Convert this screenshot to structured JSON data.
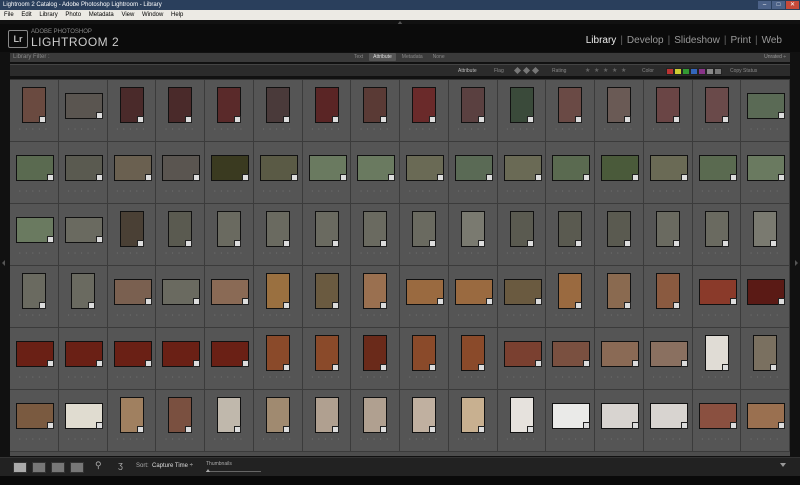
{
  "window": {
    "title": "Lightroom 2 Catalog - Adobe Photoshop Lightroom - Library",
    "controls": [
      "–",
      "□",
      "✕"
    ]
  },
  "menu": [
    "File",
    "Edit",
    "Library",
    "Photo",
    "Metadata",
    "View",
    "Window",
    "Help"
  ],
  "logo": {
    "badge": "Lr",
    "subtitle": "ADOBE PHOTOSHOP",
    "title": "LIGHTROOM 2"
  },
  "modules": [
    {
      "label": "Library",
      "active": true
    },
    {
      "label": "Develop",
      "active": false
    },
    {
      "label": "Slideshow",
      "active": false
    },
    {
      "label": "Print",
      "active": false
    },
    {
      "label": "Web",
      "active": false
    }
  ],
  "filter": {
    "title": "Library Filter :",
    "tabs": [
      {
        "label": "Text",
        "active": false
      },
      {
        "label": "Attribute",
        "active": true
      },
      {
        "label": "Metadata",
        "active": false
      },
      {
        "label": "None",
        "active": false
      }
    ],
    "preset": "Unrated ÷"
  },
  "attribute_bar": {
    "attribute_label": "Attribute",
    "flag_label": "Flag",
    "rating_label": "Rating",
    "color_label": "Color",
    "copy_status_label": "Copy Status",
    "colors": [
      "#b33",
      "#cc3",
      "#393",
      "#36b",
      "#838",
      "#888",
      "#777"
    ]
  },
  "thumbnails": [
    "p",
    "l",
    "p",
    "p",
    "p",
    "p",
    "p",
    "p",
    "p",
    "p",
    "p",
    "p",
    "p",
    "p",
    "p",
    "l",
    "l",
    "l",
    "l",
    "l",
    "l",
    "l",
    "l",
    "l",
    "l",
    "l",
    "l",
    "l",
    "l",
    "l",
    "l",
    "l",
    "l",
    "l",
    "p",
    "p",
    "p",
    "p",
    "p",
    "p",
    "p",
    "p",
    "p",
    "p",
    "p",
    "p",
    "p",
    "p",
    "p",
    "p",
    "l",
    "l",
    "l",
    "p",
    "p",
    "p",
    "l",
    "l",
    "l",
    "p",
    "p",
    "p",
    "l",
    "l",
    "l",
    "l",
    "l",
    "l",
    "l",
    "p",
    "p",
    "p",
    "p",
    "p",
    "l",
    "l",
    "l",
    "l",
    "p",
    "p",
    "l",
    "l",
    "p",
    "p",
    "p",
    "p",
    "p",
    "p",
    "p",
    "p",
    "p",
    "l",
    "l",
    "l",
    "l",
    "l"
  ],
  "thumb_colors": [
    "#6a4a40",
    "#5a5550",
    "#4a2a2a",
    "#4a2a2a",
    "#5a2a2a",
    "#4a3a3a",
    "#5a2525",
    "#5a3a35",
    "#6a2a2a",
    "#5a4040",
    "#3a4a3a",
    "#6a4a45",
    "#6a5a55",
    "#6a4545",
    "#6a4a4a",
    "#5a6a55",
    "#5a6a50",
    "#5a5a50",
    "#6a6050",
    "#5a5550",
    "#3a3a20",
    "#5a5a45",
    "#6a7a60",
    "#6a7a60",
    "#6a6a55",
    "#5a6a55",
    "#6a6a55",
    "#5a6a50",
    "#4a5a3a",
    "#6a6a55",
    "#5a6a50",
    "#6a7a60",
    "#6a7a60",
    "#6a6a60",
    "#4a4035",
    "#5a5a50",
    "#6a6a60",
    "#6a6a60",
    "#6a6a60",
    "#6a6a60",
    "#6a6a60",
    "#7a7a70",
    "#5a5a50",
    "#5a5a50",
    "#5a5a50",
    "#6a6a60",
    "#6a6a60",
    "#7a7a70",
    "#6a6a60",
    "#6a6a60",
    "#7a6050",
    "#6a6a60",
    "#8a6a55",
    "#9a7040",
    "#6a5a40",
    "#9a7050",
    "#9a6a40",
    "#9a6a40",
    "#6a5a40",
    "#9a6a40",
    "#8a6a50",
    "#8a5a40",
    "#8a3a2a",
    "#5a1a15",
    "#6a2015",
    "#6a2015",
    "#6a2015",
    "#6a2015",
    "#6a2015",
    "#8a4a2a",
    "#8a4a2a",
    "#6a2a1a",
    "#8a4a2a",
    "#8a4a2a",
    "#7a4030",
    "#7a5040",
    "#8a6a55",
    "#8a7060",
    "#e0dcd5",
    "#7a7060",
    "#7a5a40",
    "#e0dcd0",
    "#a08060",
    "#7a5040",
    "#c0b8ac",
    "#a08a70",
    "#b0a090",
    "#b0a090",
    "#c0b0a0",
    "#c8b090",
    "#e6e2dd",
    "#eaeae8",
    "#d8d4d0",
    "#d8d4d0",
    "#8a5040",
    "#9a7050"
  ],
  "toolbar": {
    "sort_label": "Sort:",
    "sort_value": "Capture Time ÷",
    "thumbnails_label": "Thumbnails"
  }
}
